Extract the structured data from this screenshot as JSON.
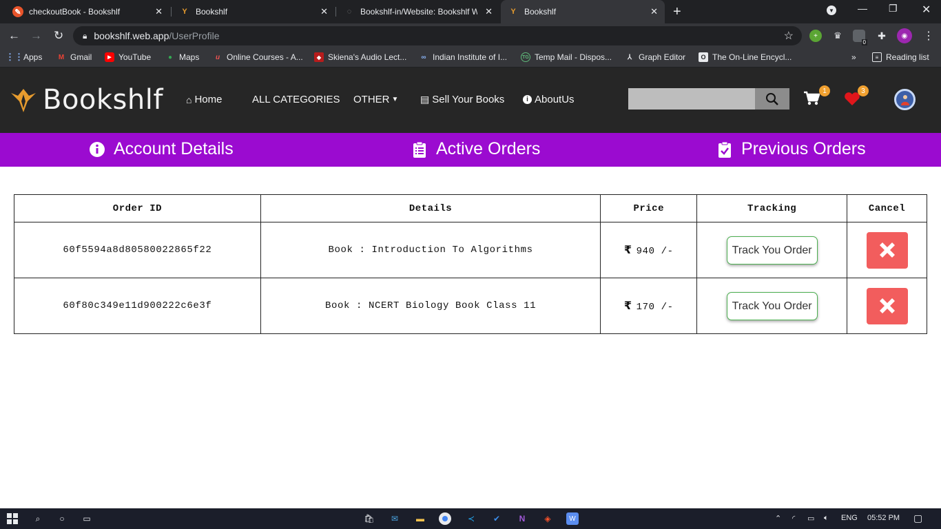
{
  "browser": {
    "tabs": [
      {
        "title": "checkoutBook - Bookshlf",
        "active": false
      },
      {
        "title": "Bookshlf",
        "active": false
      },
      {
        "title": "Bookshlf-in/Website: Bookshlf W",
        "active": false
      },
      {
        "title": "Bookshlf",
        "active": true
      }
    ],
    "url_host": "bookshlf.web.app",
    "url_path": "/UserProfile",
    "bookmarks": [
      {
        "label": "Apps",
        "icon": "apps-grid-icon"
      },
      {
        "label": "Gmail",
        "icon": "gmail-icon"
      },
      {
        "label": "YouTube",
        "icon": "youtube-icon"
      },
      {
        "label": "Maps",
        "icon": "maps-pin-icon"
      },
      {
        "label": "Online Courses - A...",
        "icon": "udemy-icon"
      },
      {
        "label": "Skiena's Audio Lect...",
        "icon": "shield-crest-icon"
      },
      {
        "label": "Indian Institute of I...",
        "icon": "link-icon"
      },
      {
        "label": "Temp Mail - Dispos...",
        "icon": "tempmail-icon"
      },
      {
        "label": "Graph Editor",
        "icon": "graph-icon"
      },
      {
        "label": "The On-Line Encycl...",
        "icon": "oeis-icon"
      }
    ],
    "reading_list": "Reading list",
    "extension_badge": "0"
  },
  "site": {
    "brand": "Bookshlf",
    "nav": {
      "home": "Home",
      "categories": "ALL CATEGORIES",
      "other": "OTHER",
      "sell": "Sell Your Books",
      "about": "AboutUs"
    },
    "search_placeholder": "",
    "cart_count": "1",
    "wishlist_count": "3"
  },
  "profile_tabs": {
    "account": "Account Details",
    "active": "Active Orders",
    "previous": "Previous Orders"
  },
  "orders": {
    "headers": {
      "id": "Order ID",
      "details": "Details",
      "price": "Price",
      "tracking": "Tracking",
      "cancel": "Cancel"
    },
    "rows": [
      {
        "id": "60f5594a8d80580022865f22",
        "details": "Book : Introduction To Algorithms",
        "price": "940 /-",
        "track": "Track You Order"
      },
      {
        "id": "60f80c349e11d900222c6e3f",
        "details": "Book : NCERT Biology Book Class 11",
        "price": "170 /-",
        "track": "Track You Order"
      }
    ]
  },
  "taskbar": {
    "language": "ENG",
    "time": "05:52 PM"
  },
  "colors": {
    "purple": "#9b0bd0",
    "header": "#262626",
    "cancel_red": "#f25d5d",
    "track_border": "#4caf50"
  }
}
